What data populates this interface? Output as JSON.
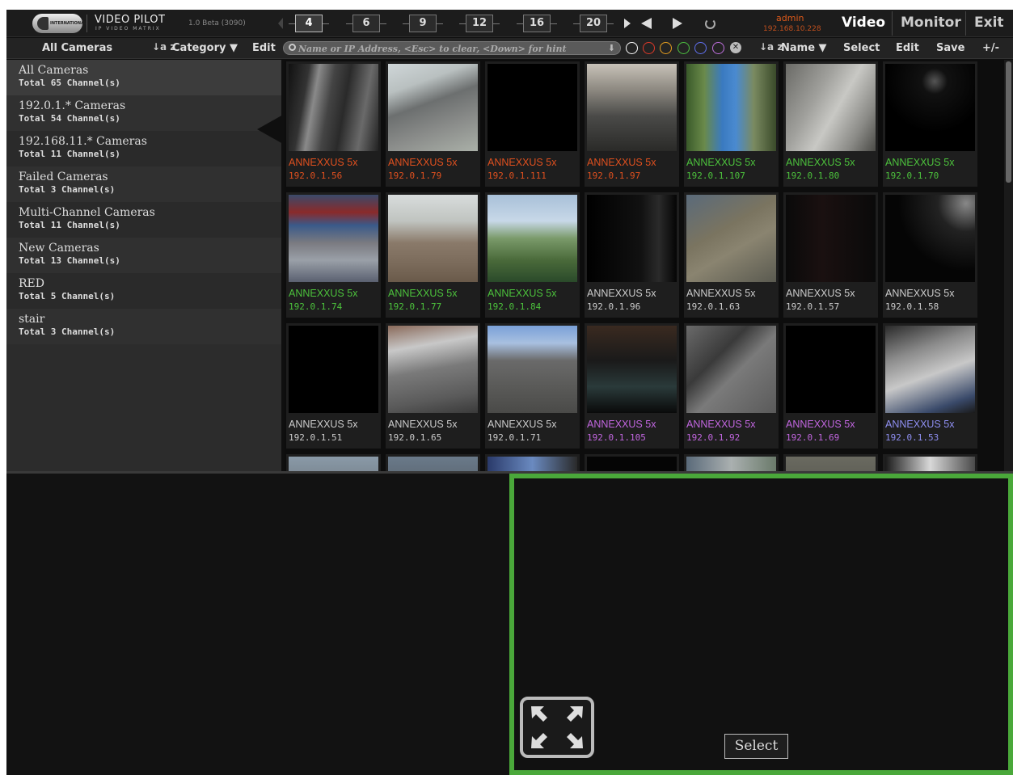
{
  "app": {
    "brand": "VIDEO PILOT",
    "brand_sub": "IP VIDEO MATRIX",
    "version": "1.0 Beta (3090)",
    "logo_text": "INTERNATIONAL"
  },
  "layouts": [
    "4",
    "6",
    "9",
    "12",
    "16",
    "20"
  ],
  "active_layout": "4",
  "user": {
    "name": "admin",
    "ip": "192.168.10.228"
  },
  "modes": {
    "video": "Video",
    "monitor": "Monitor",
    "exit": "Exit"
  },
  "toolbar": {
    "all_cameras": "All Cameras",
    "category": "Category ▼",
    "edit_left": "Edit",
    "search_placeholder": "Name or IP Address, <Esc> to clear, <Down> for hint",
    "name_sort": "Name ▼",
    "select": "Select",
    "edit_right": "Edit",
    "save": "Save",
    "plus_minus": "+/-",
    "colors": [
      "#ffffff",
      "#e03a2a",
      "#e8a020",
      "#4cc040",
      "#6070f0",
      "#c070e0"
    ]
  },
  "categories": [
    {
      "name": "All Cameras",
      "count": "Total 65 Channel(s)"
    },
    {
      "name": "192.0.1.* Cameras",
      "count": "Total 54 Channel(s)"
    },
    {
      "name": "192.168.11.* Cameras",
      "count": "Total 11 Channel(s)"
    },
    {
      "name": "Failed Cameras",
      "count": "Total 3 Channel(s)"
    },
    {
      "name": "Multi-Channel Cameras",
      "count": "Total 11 Channel(s)"
    },
    {
      "name": "New Cameras",
      "count": "Total 13 Channel(s)"
    },
    {
      "name": "RED",
      "count": "Total 5 Channel(s)"
    },
    {
      "name": "stair",
      "count": "Total 3 Channel(s)"
    }
  ],
  "cameras": [
    {
      "name": "ANNEXXUS 5x",
      "ip": "192.0.1.56",
      "color": "#e0501e"
    },
    {
      "name": "ANNEXXUS 5x",
      "ip": "192.0.1.79",
      "color": "#e0501e"
    },
    {
      "name": "ANNEXXUS 5x",
      "ip": "192.0.1.111",
      "color": "#e0501e"
    },
    {
      "name": "ANNEXXUS 5x",
      "ip": "192.0.1.97",
      "color": "#e0501e"
    },
    {
      "name": "ANNEXXUS 5x",
      "ip": "192.0.1.107",
      "color": "#4cc23c"
    },
    {
      "name": "ANNEXXUS 5x",
      "ip": "192.0.1.80",
      "color": "#4cc23c"
    },
    {
      "name": "ANNEXXUS 5x",
      "ip": "192.0.1.70",
      "color": "#4cc23c"
    },
    {
      "name": "ANNEXXUS 5x",
      "ip": "192.0.1.74",
      "color": "#4cc23c"
    },
    {
      "name": "ANNEXXUS 5x",
      "ip": "192.0.1.77",
      "color": "#4cc23c"
    },
    {
      "name": "ANNEXXUS 5x",
      "ip": "192.0.1.84",
      "color": "#4cc23c"
    },
    {
      "name": "ANNEXXUS 5x",
      "ip": "192.0.1.96",
      "color": "#cccccc"
    },
    {
      "name": "ANNEXXUS 5x",
      "ip": "192.0.1.63",
      "color": "#cccccc"
    },
    {
      "name": "ANNEXXUS 5x",
      "ip": "192.0.1.57",
      "color": "#cccccc"
    },
    {
      "name": "ANNEXXUS 5x",
      "ip": "192.0.1.58",
      "color": "#cccccc"
    },
    {
      "name": "ANNEXXUS 5x",
      "ip": "192.0.1.51",
      "color": "#cccccc"
    },
    {
      "name": "ANNEXXUS 5x",
      "ip": "192.0.1.65",
      "color": "#cccccc"
    },
    {
      "name": "ANNEXXUS 5x",
      "ip": "192.0.1.71",
      "color": "#cccccc"
    },
    {
      "name": "ANNEXXUS 5x",
      "ip": "192.0.1.105",
      "color": "#c266e0"
    },
    {
      "name": "ANNEXXUS 5x",
      "ip": "192.0.1.92",
      "color": "#c266e0"
    },
    {
      "name": "ANNEXXUS 5x",
      "ip": "192.0.1.69",
      "color": "#c266e0"
    },
    {
      "name": "ANNEXXUS 5x",
      "ip": "192.0.1.53",
      "color": "#8f8ff2"
    }
  ],
  "viewer": {
    "select_label": "Select"
  }
}
